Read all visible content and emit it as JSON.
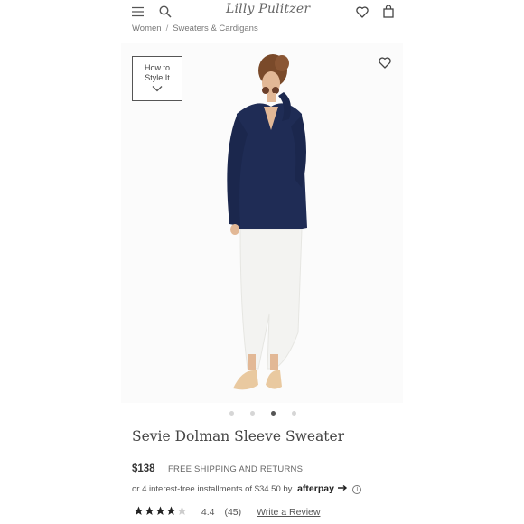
{
  "header": {
    "brand": "Lilly Pulitzer",
    "icons": [
      "menu-icon",
      "search-icon",
      "wishlist-heart-icon",
      "shopping-bag-icon"
    ]
  },
  "breadcrumb": {
    "items": [
      "Women",
      "Sweaters & Cardigans"
    ],
    "separator": "/"
  },
  "media": {
    "style_button_line1": "How to",
    "style_button_line2": "Style It",
    "carousel_dots": 4,
    "active_dot": 3
  },
  "product": {
    "title": "Sevie Dolman Sleeve Sweater",
    "price": "$138",
    "shipping": "FREE SHIPPING AND RETURNS",
    "installments_text": "or 4 interest-free installments of $34.50 by",
    "afterpay_label": "afterpay",
    "rating_value": "4.4",
    "review_count": "(45)",
    "write_review": "Write a Review",
    "stars": 4.4
  },
  "colors": {
    "sweater": "#1f2c55",
    "pants": "#f4f4f2",
    "background": "#fbfbfb"
  }
}
